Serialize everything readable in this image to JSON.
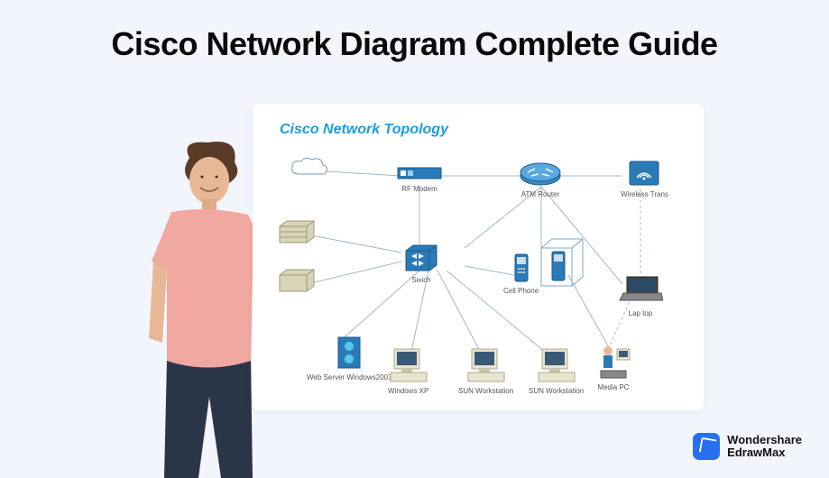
{
  "title": "Cisco Network Diagram Complete Guide",
  "diagram": {
    "title": "Cisco Network Topology",
    "nodes": {
      "cloud": {
        "label": ""
      },
      "rf_modem": {
        "label": "RF Modem"
      },
      "atm_router": {
        "label": "ATM Router"
      },
      "wireless_trans": {
        "label": "Wireless Trans"
      },
      "storage1": {
        "label": ""
      },
      "storage2": {
        "label": ""
      },
      "switch": {
        "label": "Swich"
      },
      "cell_phone": {
        "label": "Cell Phone"
      },
      "phone_device": {
        "label": ""
      },
      "laptop": {
        "label": "Lap top"
      },
      "web_server": {
        "label": "Web Server Windows2003"
      },
      "windows_xp": {
        "label": "Windows XP"
      },
      "sun_ws1": {
        "label": "SUN Workstation"
      },
      "sun_ws2": {
        "label": "SUN Workstation"
      },
      "media_pc": {
        "label": "Media PC"
      }
    }
  },
  "brand": {
    "line1": "Wondershare",
    "line2": "EdrawMax"
  }
}
